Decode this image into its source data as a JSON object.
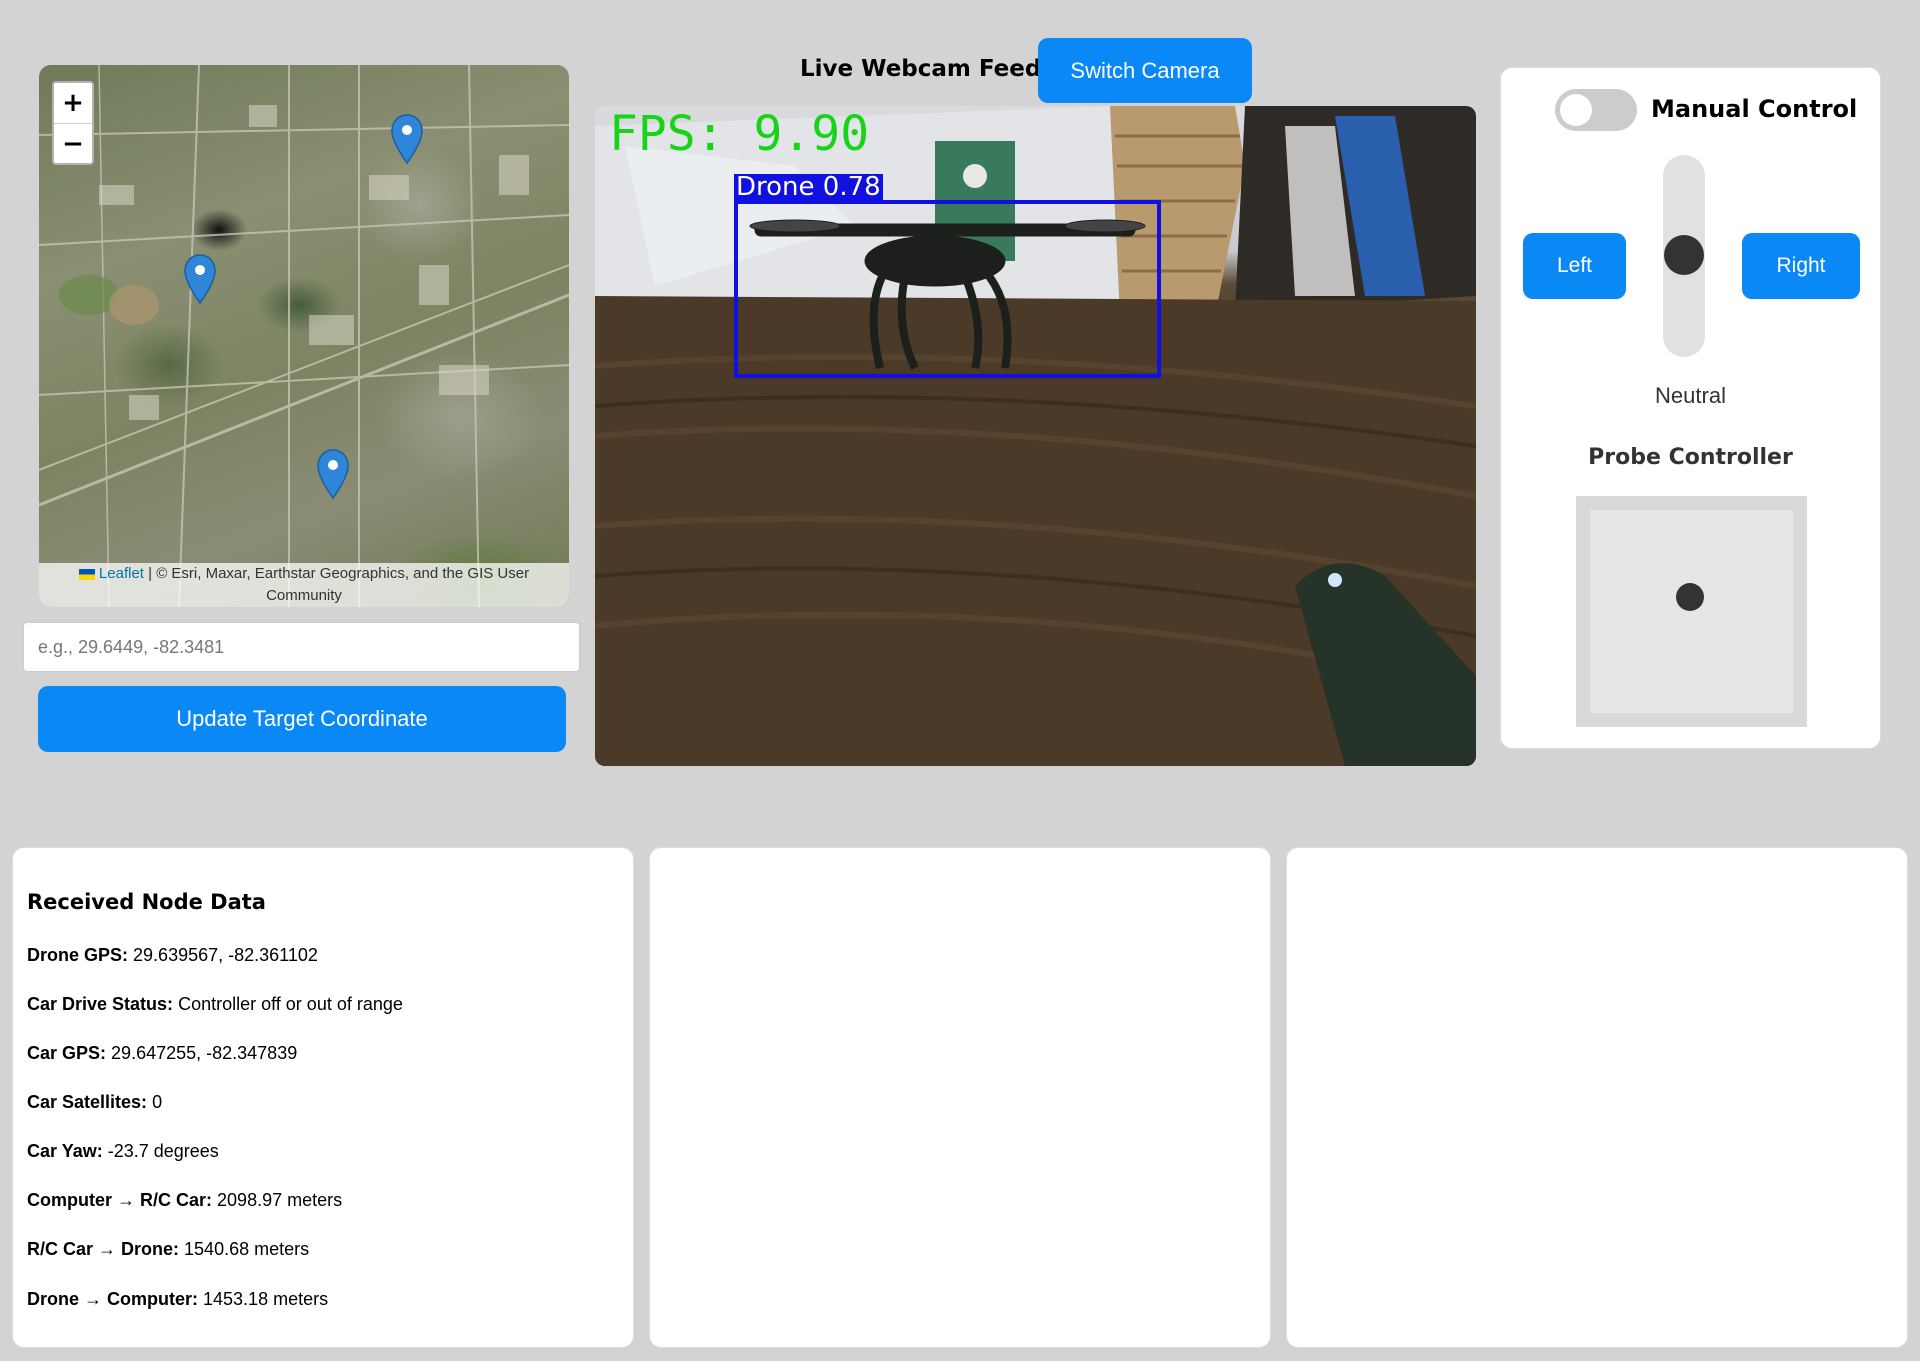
{
  "map": {
    "zoom_in": "+",
    "zoom_out": "−",
    "attribution_link": "Leaflet",
    "attribution_text": "| © Esri, Maxar, Earthstar Geographics, and the GIS User Community"
  },
  "target": {
    "placeholder": "e.g., 29.6449, -82.3481",
    "value": "",
    "button_label": "Update Target Coordinate"
  },
  "webcam": {
    "title": "Live Webcam Feed",
    "switch_label": "Switch Camera",
    "fps_overlay": "FPS: 9.90",
    "detection_label": "Drone 0.78",
    "colors": {
      "fps": "#18d418",
      "box": "#1010e0"
    }
  },
  "control": {
    "manual_label": "Manual Control",
    "manual_enabled": false,
    "left_label": "Left",
    "right_label": "Right",
    "throttle_state": "Neutral",
    "probe_title": "Probe Controller"
  },
  "node_data": {
    "title": "Received Node Data",
    "rows": [
      {
        "label": "Drone GPS:",
        "value": "29.639567, -82.361102"
      },
      {
        "label": "Car Drive Status:",
        "value": "Controller off or out of range"
      },
      {
        "label": "Car GPS:",
        "value": "29.647255, -82.347839"
      },
      {
        "label": "Car Satellites:",
        "value": "0"
      },
      {
        "label": "Car Yaw:",
        "value": "-23.7 degrees"
      },
      {
        "label": "Computer → R/C Car:",
        "value": "2098.97 meters"
      },
      {
        "label": "R/C Car → Drone:",
        "value": "1540.68 meters"
      },
      {
        "label": "Drone → Computer:",
        "value": "1453.18 meters"
      }
    ]
  },
  "theme": {
    "accent": "#0a88f5",
    "background": "#d3d3d3"
  }
}
